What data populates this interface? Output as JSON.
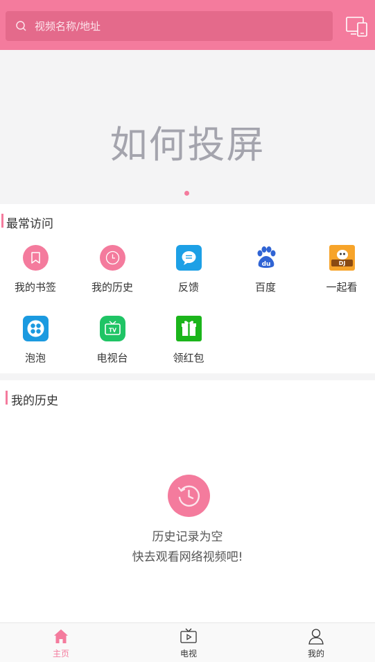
{
  "header": {
    "search_placeholder": "视频名称/地址",
    "accent_color": "#f47b9d"
  },
  "banner": {
    "text": "如何投屏",
    "page_indicator": "1"
  },
  "frequent": {
    "title": "最常访问",
    "items": [
      {
        "label": "我的书签",
        "icon": "bookmark-icon"
      },
      {
        "label": "我的历史",
        "icon": "clock-icon"
      },
      {
        "label": "反馈",
        "icon": "chat-bubble-icon"
      },
      {
        "label": "百度",
        "icon": "baidu-paw-icon"
      },
      {
        "label": "一起看",
        "icon": "yiqikan-logo-icon"
      },
      {
        "label": "泡泡",
        "icon": "paopao-icon"
      },
      {
        "label": "电视台",
        "icon": "tv-icon"
      },
      {
        "label": "领红包",
        "icon": "gift-icon"
      }
    ]
  },
  "history": {
    "title": "我的历史",
    "empty_line1": "历史记录为空",
    "empty_line2": "快去观看网络视频吧!"
  },
  "tabbar": {
    "items": [
      {
        "label": "主页",
        "icon": "home-icon",
        "active": true
      },
      {
        "label": "电视",
        "icon": "tv-play-icon",
        "active": false
      },
      {
        "label": "我的",
        "icon": "user-icon",
        "active": false
      }
    ]
  }
}
